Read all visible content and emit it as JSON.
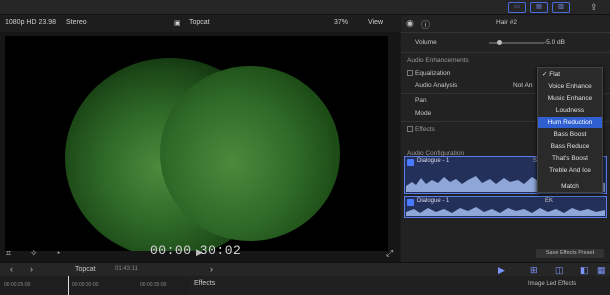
{
  "viewer": {
    "format": "1080p HD 23.98",
    "audio": "Stereo",
    "clip_name": "Topcat",
    "zoom": "37%",
    "view_label": "View",
    "timecode": "00:00 30:02"
  },
  "inspector": {
    "track_title": "Hair #2",
    "volume_label": "Volume",
    "volume_value": "-5.0 dB",
    "audio_enhancements": "Audio Enhancements",
    "equalization": "Equalization",
    "audio_analysis": "Audio Analysis",
    "audio_analysis_value": "Not An",
    "pan": "Pan",
    "mode": "Mode",
    "effects": "Effects",
    "audio_configuration": "Audio Configuration",
    "save_preset": "Save Effects Preset"
  },
  "eq_menu": {
    "items": [
      "Flat",
      "Voice Enhance",
      "Music Enhance",
      "Loudness",
      "Hum Reduction",
      "Bass Boost",
      "Bass Reduce",
      "That's Boost",
      "Treble And Ice",
      "Match"
    ],
    "checked": "Flat",
    "highlighted": "Hum Reduction"
  },
  "clips": [
    {
      "name": "Dialogue - 1",
      "badge": "S"
    },
    {
      "name": "Dialogue - 1",
      "badge": "EK"
    }
  ],
  "timeline": {
    "project": "Topcat",
    "duration": "01:43:11",
    "ruler_start": "00:00:25:00",
    "ruler_mid": "00:00:30:00",
    "ruler_end": "00:00:35:00",
    "effects_title": "Effects",
    "installed_effects": "Image Led Effects"
  },
  "colors": {
    "accent": "#4a78ff",
    "selection": "#2f5fd0",
    "night_vision": "#3f7a32"
  }
}
